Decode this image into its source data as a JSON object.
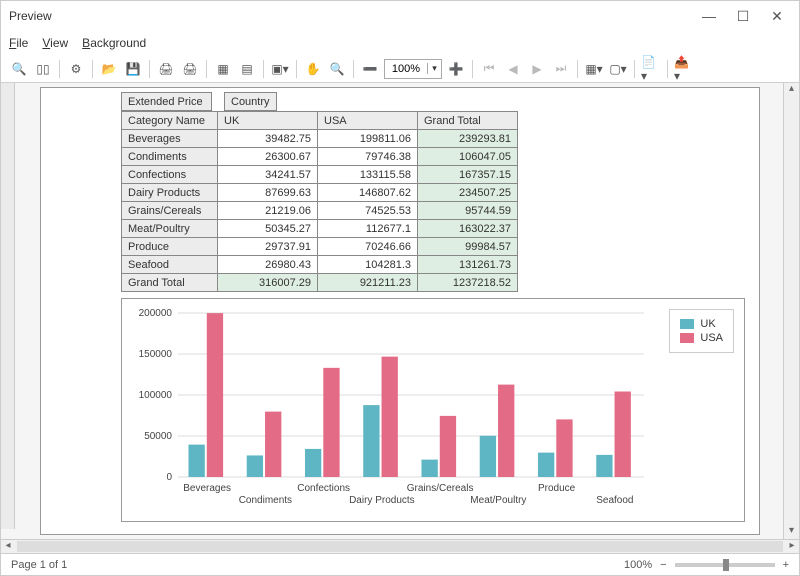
{
  "window": {
    "title": "Preview"
  },
  "menu": {
    "file": "File",
    "view": "View",
    "background": "Background"
  },
  "toolbar": {
    "zoom_value": "100%"
  },
  "table": {
    "top_left": "Extended Price",
    "top_right": "Country",
    "row_header": "Category Name",
    "cols": [
      "UK",
      "USA"
    ],
    "grand_total": "Grand Total",
    "rows": [
      {
        "name": "Beverages",
        "uk": "39482.75",
        "usa": "199811.06",
        "gt": "239293.81"
      },
      {
        "name": "Condiments",
        "uk": "26300.67",
        "usa": "79746.38",
        "gt": "106047.05"
      },
      {
        "name": "Confections",
        "uk": "34241.57",
        "usa": "133115.58",
        "gt": "167357.15"
      },
      {
        "name": "Dairy Products",
        "uk": "87699.63",
        "usa": "146807.62",
        "gt": "234507.25"
      },
      {
        "name": "Grains/Cereals",
        "uk": "21219.06",
        "usa": "74525.53",
        "gt": "95744.59"
      },
      {
        "name": "Meat/Poultry",
        "uk": "50345.27",
        "usa": "112677.1",
        "gt": "163022.37"
      },
      {
        "name": "Produce",
        "uk": "29737.91",
        "usa": "70246.66",
        "gt": "99984.57"
      },
      {
        "name": "Seafood",
        "uk": "26980.43",
        "usa": "104281.3",
        "gt": "131261.73"
      }
    ],
    "totals": {
      "name": "Grand Total",
      "uk": "316007.29",
      "usa": "921211.23",
      "gt": "1237218.52"
    }
  },
  "chart_data": {
    "type": "bar",
    "categories": [
      "Beverages",
      "Condiments",
      "Confections",
      "Dairy Products",
      "Grains/Cereals",
      "Meat/Poultry",
      "Produce",
      "Seafood"
    ],
    "series": [
      {
        "name": "UK",
        "color": "#5EB6C4",
        "values": [
          39482.75,
          26300.67,
          34241.57,
          87699.63,
          21219.06,
          50345.27,
          29737.91,
          26980.43
        ]
      },
      {
        "name": "USA",
        "color": "#E46B85",
        "values": [
          199811.06,
          79746.38,
          133115.58,
          146807.62,
          74525.53,
          112677.1,
          70246.66,
          104281.3
        ]
      }
    ],
    "ylim": [
      0,
      200000
    ],
    "yticks": [
      0,
      50000,
      100000,
      150000,
      200000
    ],
    "xlabel": "",
    "ylabel": "",
    "title": ""
  },
  "status": {
    "page": "Page 1 of 1",
    "zoom": "100%"
  }
}
